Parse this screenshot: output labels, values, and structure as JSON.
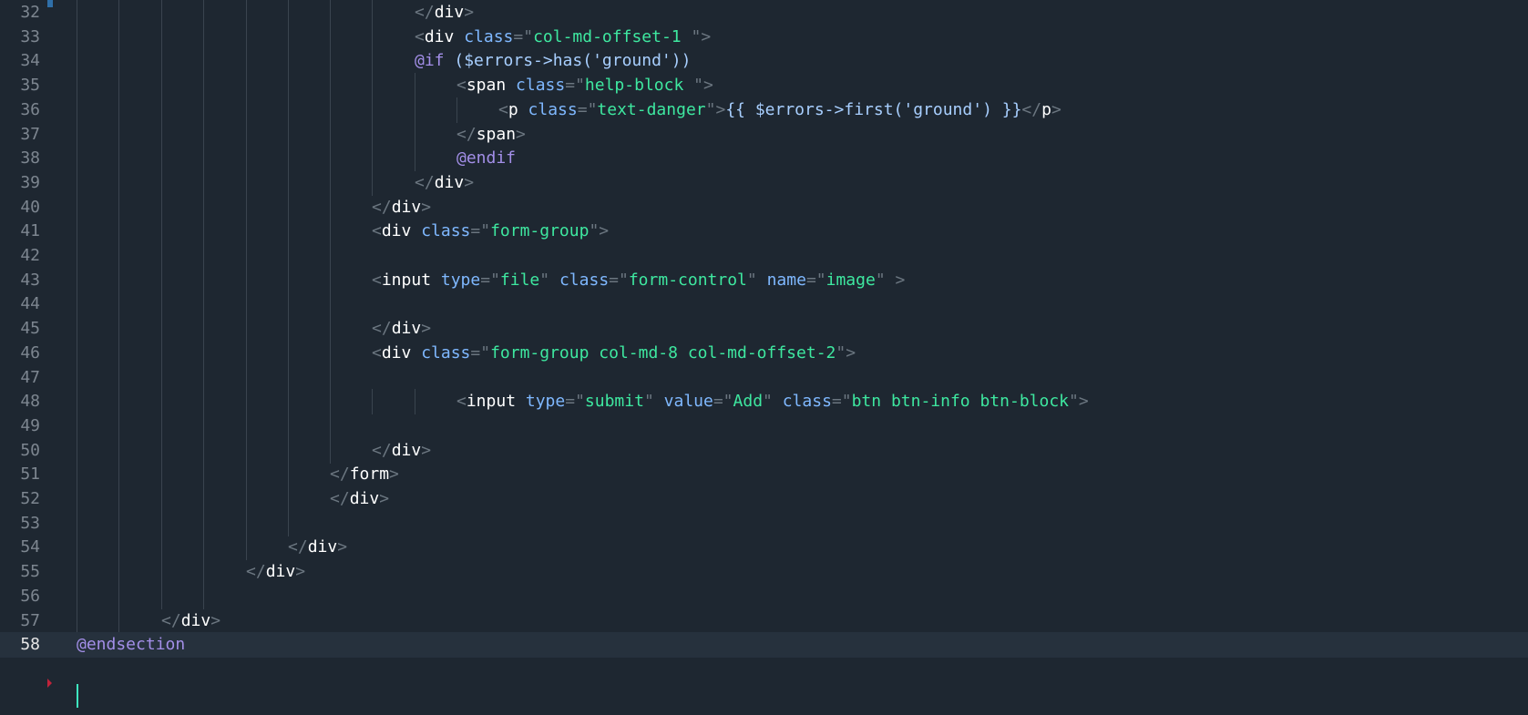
{
  "editor": {
    "colors": {
      "background": "#1e2731",
      "line_number": "#7d8690",
      "tag": "#ffffff",
      "attribute": "#7fb8ff",
      "string": "#3ee8a0",
      "directive": "#a38fe8",
      "punctuation": "#6b7680"
    },
    "current_line": "58",
    "lines": [
      {
        "n": "32",
        "code": "</div>"
      },
      {
        "n": "33",
        "code": "<div class=\"col-md-offset-1 \">"
      },
      {
        "n": "34",
        "code": "@if ($errors->has('ground'))"
      },
      {
        "n": "35",
        "code": "<span class=\"help-block \">"
      },
      {
        "n": "36",
        "code": "<p class=\"text-danger\">{{ $errors->first('ground') }}</p>"
      },
      {
        "n": "37",
        "code": "</span>"
      },
      {
        "n": "38",
        "code": "@endif"
      },
      {
        "n": "39",
        "code": "</div>"
      },
      {
        "n": "40",
        "code": "</div>"
      },
      {
        "n": "41",
        "code": "<div class=\"form-group\">"
      },
      {
        "n": "42",
        "code": ""
      },
      {
        "n": "43",
        "code": "<input type=\"file\" class=\"form-control\" name=\"image\" >"
      },
      {
        "n": "44",
        "code": ""
      },
      {
        "n": "45",
        "code": "</div>"
      },
      {
        "n": "46",
        "code": "<div class=\"form-group col-md-8 col-md-offset-2\">"
      },
      {
        "n": "47",
        "code": ""
      },
      {
        "n": "48",
        "code": "<input type=\"submit\" value=\"Add\" class=\"btn btn-info btn-block\">"
      },
      {
        "n": "49",
        "code": ""
      },
      {
        "n": "50",
        "code": "</div>"
      },
      {
        "n": "51",
        "code": "</form>"
      },
      {
        "n": "52",
        "code": "</div>"
      },
      {
        "n": "53",
        "code": ""
      },
      {
        "n": "54",
        "code": "</div>"
      },
      {
        "n": "55",
        "code": "</div>"
      },
      {
        "n": "56",
        "code": ""
      },
      {
        "n": "57",
        "code": "</div>"
      },
      {
        "n": "58",
        "code": "@endsection"
      }
    ]
  }
}
